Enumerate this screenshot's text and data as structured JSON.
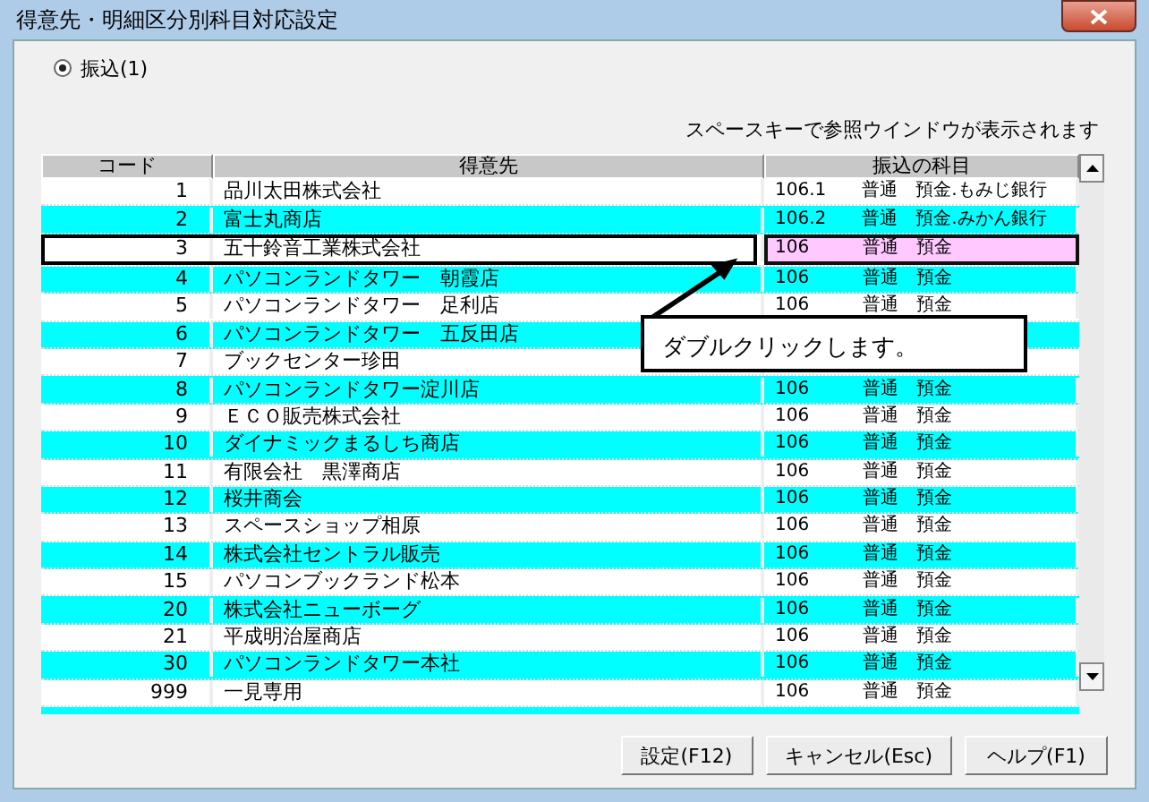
{
  "window": {
    "title": "得意先・明細区分別科目対応設定"
  },
  "radio": {
    "label": "振込(1)",
    "selected": true
  },
  "hint": "スペースキーで参照ウインドウが表示されます",
  "table": {
    "columns": [
      "コード",
      "得意先",
      "振込の科目"
    ],
    "rows": [
      {
        "code": "1",
        "name": "品川太田株式会社",
        "account": "106.1　　普通　預金.もみじ銀行",
        "selected": false
      },
      {
        "code": "2",
        "name": "富士丸商店",
        "account": "106.2　　普通　預金.みかん銀行",
        "selected": false
      },
      {
        "code": "3",
        "name": "五十鈴音工業株式会社",
        "account": "106　　　普通　預金",
        "selected": true
      },
      {
        "code": "4",
        "name": "パソコンランドタワー　朝霞店",
        "account": "106　　　普通　預金",
        "selected": false
      },
      {
        "code": "5",
        "name": "パソコンランドタワー　足利店",
        "account": "106　　　普通　預金",
        "selected": false
      },
      {
        "code": "6",
        "name": "パソコンランドタワー　五反田店",
        "selected": false
      },
      {
        "code": "7",
        "name": "ブックセンター珍田",
        "selected": false
      },
      {
        "code": "8",
        "name": "パソコンランドタワー淀川店",
        "account": "106　　　普通　預金",
        "selected": false
      },
      {
        "code": "9",
        "name": "ＥＣＯ販売株式会社",
        "account": "106　　　普通　預金",
        "selected": false
      },
      {
        "code": "10",
        "name": "ダイナミックまるしち商店",
        "account": "106　　　普通　預金",
        "selected": false
      },
      {
        "code": "11",
        "name": "有限会社　黒澤商店",
        "account": "106　　　普通　預金",
        "selected": false
      },
      {
        "code": "12",
        "name": "桜井商会",
        "account": "106　　　普通　預金",
        "selected": false
      },
      {
        "code": "13",
        "name": "スペースショップ相原",
        "account": "106　　　普通　預金",
        "selected": false
      },
      {
        "code": "14",
        "name": "株式会社セントラル販売",
        "account": "106　　　普通　預金",
        "selected": false
      },
      {
        "code": "15",
        "name": "パソコンブックランド松本",
        "account": "106　　　普通　預金",
        "selected": false
      },
      {
        "code": "20",
        "name": "株式会社ニューボーグ",
        "account": "106　　　普通　預金",
        "selected": false
      },
      {
        "code": "21",
        "name": "平成明治屋商店",
        "account": "106　　　普通　預金",
        "selected": false
      },
      {
        "code": "30",
        "name": "パソコンランドタワー本社",
        "account": "106　　　普通　預金",
        "selected": false
      },
      {
        "code": "999",
        "name": "一見専用",
        "account": "106　　　普通　預金",
        "selected": false
      }
    ]
  },
  "callout": "ダブルクリックします。",
  "buttons": [
    "設定(F12)",
    "キャンセル(Esc)",
    "ヘルプ(F1)"
  ]
}
